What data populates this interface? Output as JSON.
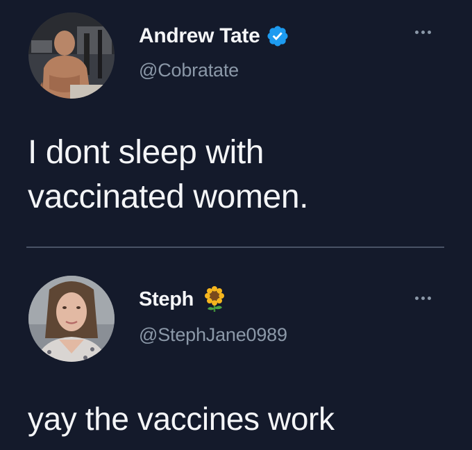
{
  "colors": {
    "background": "#141a2b",
    "verified": "#1d9bf0",
    "secondary_text": "#8b98a8",
    "divider": "#4a5366"
  },
  "tweet": {
    "author": {
      "display_name": "Andrew Tate",
      "handle": "@Cobratate",
      "badge": "verified-badge-icon",
      "avatar": "avatar-man-shirtless-gym"
    },
    "text": "I dont sleep with\nvaccinated women.",
    "menu_icon": "more-options-icon"
  },
  "reply": {
    "author": {
      "display_name": "Steph",
      "handle": "@StephJane0989",
      "name_emoji": "sunflower-icon",
      "avatar": "avatar-woman-portrait"
    },
    "text": "yay the vaccines work",
    "menu_icon": "more-options-icon"
  }
}
